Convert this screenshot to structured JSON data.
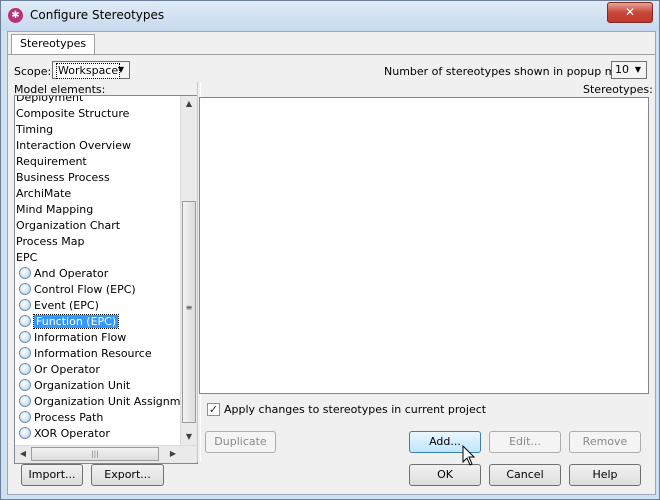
{
  "window": {
    "title": "Configure Stereotypes",
    "app_icon": "vp-logo-icon",
    "close_glyph": "✕"
  },
  "tabs": [
    {
      "label": "Stereotypes"
    }
  ],
  "scope": {
    "label": "Scope:",
    "value": "Workspace"
  },
  "popup_count": {
    "label": "Number of stereotypes shown in popup menu:",
    "value": "10"
  },
  "model_elements": {
    "label": "Model elements:",
    "items": [
      {
        "label": "Deployment",
        "child": false
      },
      {
        "label": "Composite Structure",
        "child": false
      },
      {
        "label": "Timing",
        "child": false
      },
      {
        "label": "Interaction Overview",
        "child": false
      },
      {
        "label": "Requirement",
        "child": false
      },
      {
        "label": "Business Process",
        "child": false
      },
      {
        "label": "ArchiMate",
        "child": false
      },
      {
        "label": "Mind Mapping",
        "child": false
      },
      {
        "label": "Organization Chart",
        "child": false
      },
      {
        "label": "Process Map",
        "child": false
      },
      {
        "label": "EPC",
        "child": false
      },
      {
        "label": "And Operator",
        "child": true
      },
      {
        "label": "Control Flow (EPC)",
        "child": true
      },
      {
        "label": "Event (EPC)",
        "child": true
      },
      {
        "label": "Function (EPC)",
        "child": true,
        "selected": true
      },
      {
        "label": "Information Flow",
        "child": true
      },
      {
        "label": "Information Resource",
        "child": true
      },
      {
        "label": "Or Operator",
        "child": true
      },
      {
        "label": "Organization Unit",
        "child": true
      },
      {
        "label": "Organization Unit Assignment",
        "child": true
      },
      {
        "label": "Process Path",
        "child": true
      },
      {
        "label": "XOR Operator",
        "child": true
      }
    ]
  },
  "stereotypes": {
    "label": "Stereotypes:"
  },
  "apply_changes": {
    "label": "Apply changes to stereotypes in current project",
    "checked": true
  },
  "buttons": {
    "duplicate": "Duplicate",
    "add": "Add...",
    "edit": "Edit...",
    "remove": "Remove",
    "import": "Import...",
    "export": "Export...",
    "ok": "OK",
    "cancel": "Cancel",
    "help": "Help"
  },
  "glyphs": {
    "dropdown": "▼",
    "up": "▲",
    "down": "▼",
    "left": "◀",
    "right": "▶",
    "check": "✓",
    "grip_v": "≡",
    "grip_h": "|||"
  },
  "colors": {
    "selection": "#3399ff",
    "title_gradient_top": "#dfeaf6",
    "close_red": "#c8473a"
  }
}
